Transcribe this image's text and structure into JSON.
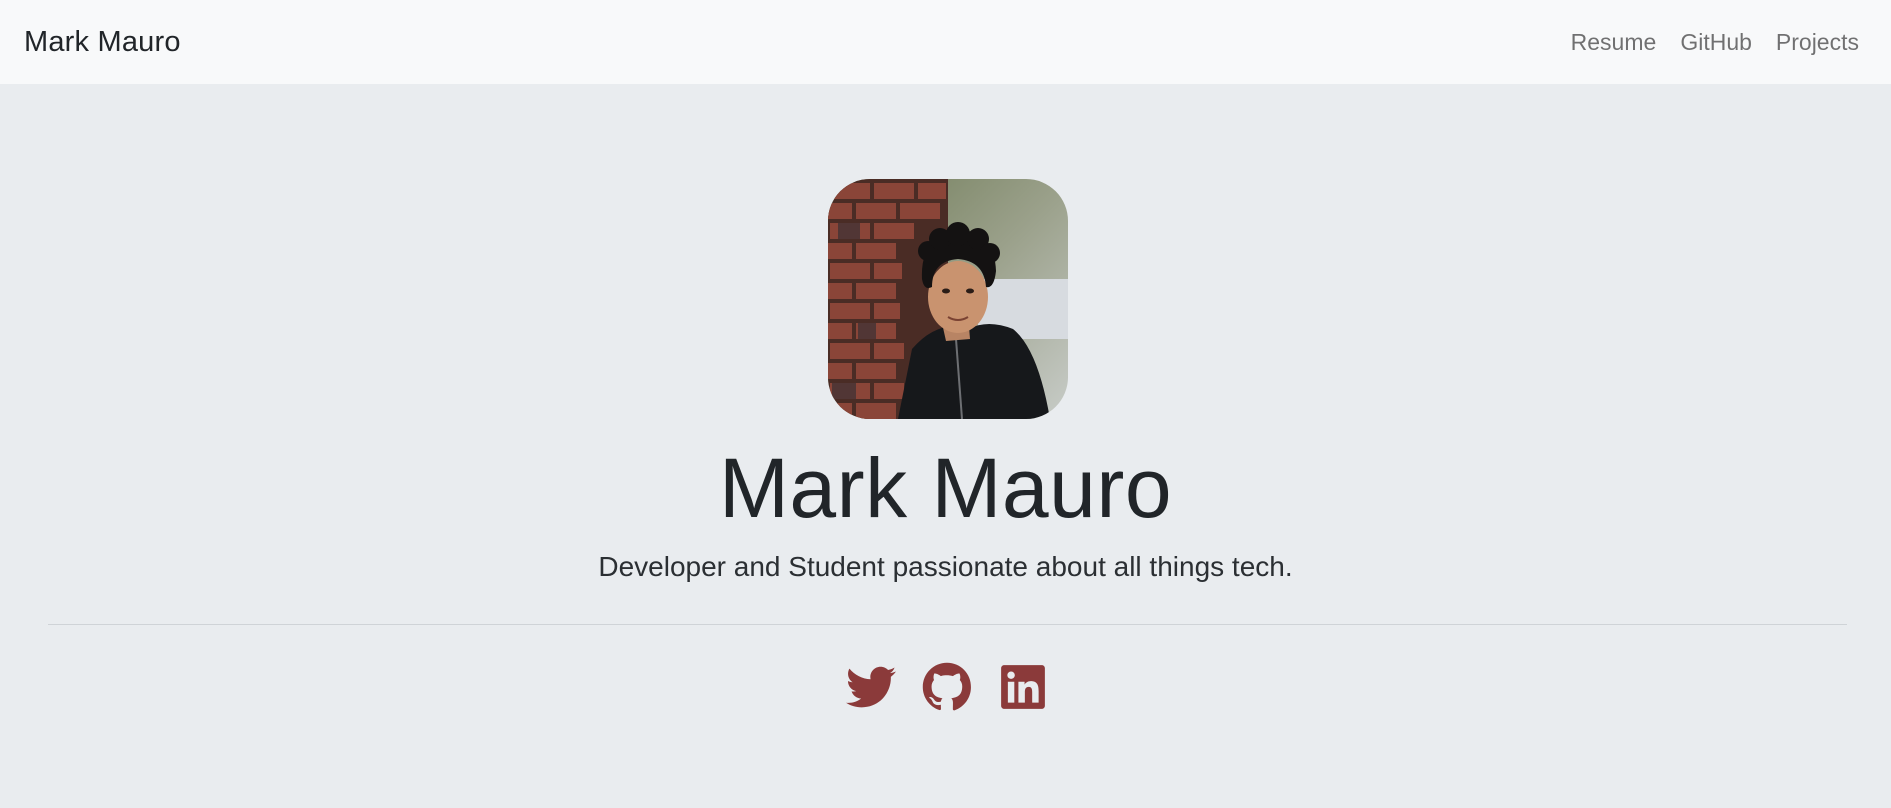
{
  "navbar": {
    "brand": "Mark Mauro",
    "links": [
      {
        "label": "Resume"
      },
      {
        "label": "GitHub"
      },
      {
        "label": "Projects"
      }
    ]
  },
  "hero": {
    "title": "Mark Mauro",
    "subtitle": "Developer and Student passionate about all things tech.",
    "avatar_icon": "profile-photo"
  },
  "socials": [
    {
      "icon": "twitter-icon"
    },
    {
      "icon": "github-icon"
    },
    {
      "icon": "linkedin-icon"
    }
  ],
  "colors": {
    "navbar_bg": "#f8f9fa",
    "page_bg": "#e9ecef",
    "social_icon": "#8b3a3a",
    "nav_link": "#808080"
  }
}
